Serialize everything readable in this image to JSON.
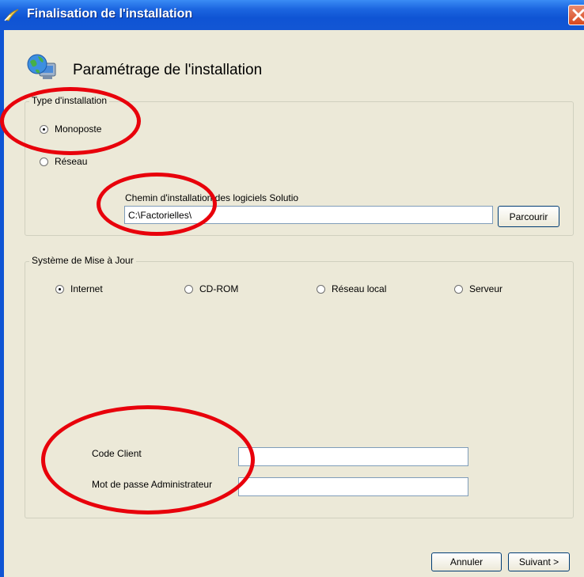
{
  "window": {
    "title": "Finalisation de l'installation"
  },
  "header": {
    "title": "Paramétrage de l'installation"
  },
  "install_type": {
    "legend": "Type d'installation",
    "options": [
      {
        "label": "Monoposte",
        "selected": true
      },
      {
        "label": "Réseau",
        "selected": false
      }
    ],
    "path_label": "Chemin d'installation des logiciels Solutio",
    "path_value": "C:\\Factorielles\\",
    "browse_label": "Parcourir"
  },
  "update_system": {
    "legend": "Système de Mise à Jour",
    "options": [
      {
        "label": "Internet",
        "selected": true
      },
      {
        "label": "CD-ROM",
        "selected": false
      },
      {
        "label": "Réseau local",
        "selected": false
      },
      {
        "label": "Serveur",
        "selected": false
      }
    ],
    "client_code_label": "Code Client",
    "client_code_value": "",
    "admin_password_label": "Mot de passe Administrateur",
    "admin_password_value": ""
  },
  "footer": {
    "cancel_label": "Annuler",
    "next_label": "Suivant >"
  },
  "colors": {
    "titlebar": "#0f54d4",
    "dialog_bg": "#ece9d8",
    "annotation": "#e8000b"
  },
  "icons": {
    "app": "app-icon",
    "header": "globe-computer-icon",
    "close": "close-icon"
  }
}
